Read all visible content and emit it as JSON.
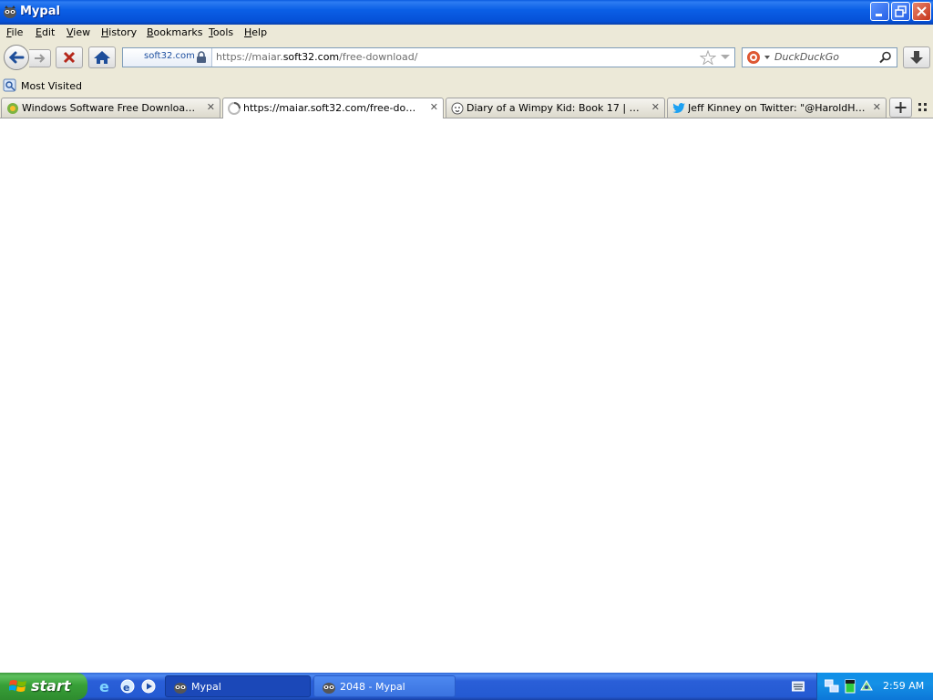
{
  "window": {
    "title": "Mypal"
  },
  "menubar": {
    "items": [
      {
        "label": "File",
        "ul": "F",
        "rest": "ile"
      },
      {
        "label": "Edit",
        "ul": "E",
        "rest": "dit"
      },
      {
        "label": "View",
        "ul": "V",
        "rest": "iew"
      },
      {
        "label": "History",
        "ul": "H",
        "rest": "istory"
      },
      {
        "label": "Bookmarks",
        "ul": "B",
        "rest": "ookmarks"
      },
      {
        "label": "Tools",
        "ul": "T",
        "rest": "ools"
      },
      {
        "label": "Help",
        "ul": "H",
        "rest": "elp"
      }
    ]
  },
  "navbar": {
    "identity_host": "soft32.com",
    "url_prefix": "https://maiar.",
    "url_domain": "soft32.com",
    "url_path": "/free-download/",
    "search_placeholder": "DuckDuckGo"
  },
  "bookmarks": {
    "most_visited": "Most Visited"
  },
  "tabs": [
    {
      "label": "Windows Software Free Download - So...",
      "selected": false
    },
    {
      "label": "https://maiar.soft32.com/free-download/",
      "selected": true
    },
    {
      "label": "Diary of a Wimpy Kid: Book 17 | Diary o...",
      "selected": false
    },
    {
      "label": "Jeff Kinney on Twitter: \"@HaroldH6607...",
      "selected": false
    }
  ],
  "taskbar": {
    "start_label": "start",
    "tasks": [
      {
        "label": "Mypal",
        "active": true
      },
      {
        "label": "2048 - Mypal",
        "active": false
      }
    ],
    "clock": "2:59 AM"
  },
  "colors": {
    "titlebar": "#0b5fe6",
    "chrome": "#ece9d8",
    "taskbar": "#245ad2",
    "start": "#38a038"
  }
}
